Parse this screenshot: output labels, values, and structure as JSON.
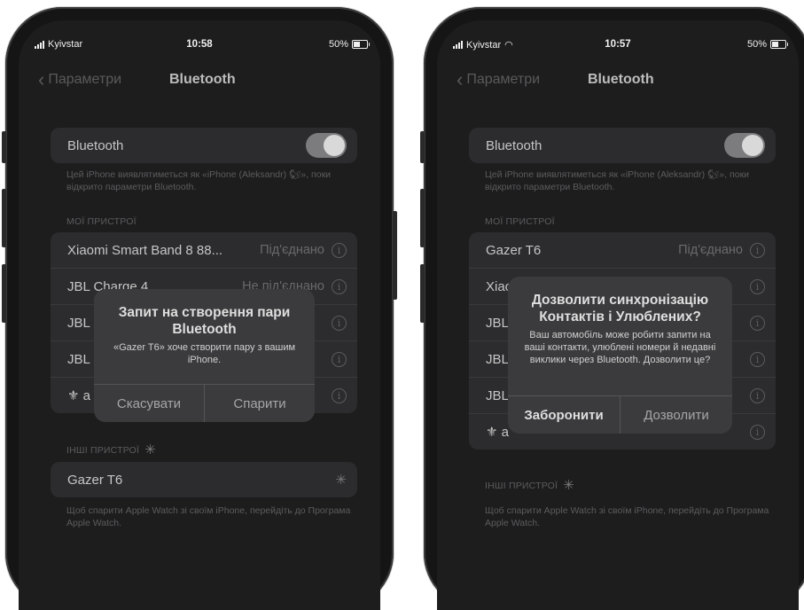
{
  "left": {
    "status": {
      "carrier": "Kyivstar",
      "time": "10:58",
      "battery": "50%"
    },
    "nav": {
      "back": "Параметри",
      "title": "Bluetooth"
    },
    "bluetooth_toggle": {
      "label": "Bluetooth",
      "on": true
    },
    "visibility_note": "Цей iPhone виявлятиметься як «iPhone (Aleksandr) 🐿», поки відкрито параметри Bluetooth.",
    "my_devices_header": "МОЇ ПРИСТРОЇ",
    "my_devices": [
      {
        "name": "Xiaomi Smart Band 8 88...",
        "status": "Під'єднано"
      },
      {
        "name": "JBL Charge 4",
        "status": "Не під'єднано"
      },
      {
        "name": "JBL",
        "status": ""
      },
      {
        "name": "JBL",
        "status": ""
      },
      {
        "name": "⚜ a",
        "status": ""
      }
    ],
    "other_devices_header": "ІНШІ ПРИСТРОЇ",
    "other_devices": [
      {
        "name": "Gazer T6"
      }
    ],
    "watch_note": "Щоб спарити Apple Watch зі своїм iPhone, перейдіть до Програма Apple Watch.",
    "alert": {
      "title": "Запит на створення пари Bluetooth",
      "message": "«Gazer T6» хоче створити пару з вашим iPhone.",
      "cancel": "Скасувати",
      "confirm": "Спарити"
    }
  },
  "right": {
    "status": {
      "carrier": "Kyivstar",
      "time": "10:57",
      "battery": "50%"
    },
    "nav": {
      "back": "Параметри",
      "title": "Bluetooth"
    },
    "bluetooth_toggle": {
      "label": "Bluetooth",
      "on": true
    },
    "visibility_note": "Цей iPhone виявлятиметься як «iPhone (Aleksandr) 🐿», поки відкрито параметри Bluetooth.",
    "my_devices_header": "МОЇ ПРИСТРОЇ",
    "my_devices": [
      {
        "name": "Gazer T6",
        "status": "Під'єднано"
      },
      {
        "name": "Xiao",
        "status": ""
      },
      {
        "name": "JBL",
        "status": ""
      },
      {
        "name": "JBL",
        "status": ""
      },
      {
        "name": "JBL",
        "status": ""
      },
      {
        "name": "⚜ a",
        "status": ""
      }
    ],
    "other_devices_header": "ІНШІ ПРИСТРОЇ",
    "watch_note": "Щоб спарити Apple Watch зі своїм iPhone, перейдіть до Програма Apple Watch.",
    "alert": {
      "title": "Дозволити синхронізацію Контактів і Улюблених?",
      "message": "Ваш автомобіль може робити запити на ваші контакти, улюблені номери й недавні виклики через Bluetooth. Дозволити це?",
      "cancel": "Заборонити",
      "confirm": "Дозволити"
    }
  }
}
